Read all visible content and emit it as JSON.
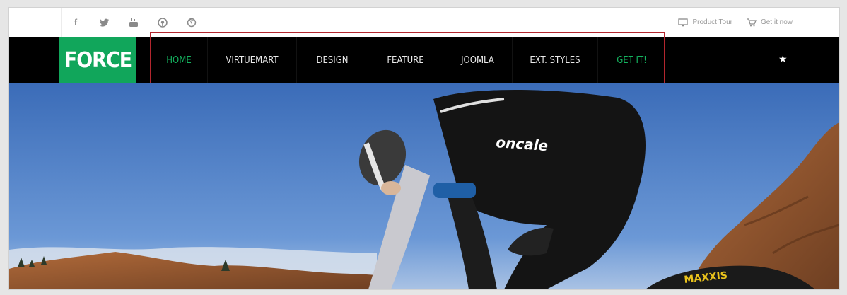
{
  "social": [
    {
      "name": "facebook-icon",
      "glyph": "f"
    },
    {
      "name": "twitter-icon",
      "glyph": "🐦"
    },
    {
      "name": "youtube-icon",
      "glyph": "▶"
    },
    {
      "name": "pinterest-icon",
      "glyph": "◉"
    },
    {
      "name": "dribbble-icon",
      "glyph": "◎"
    }
  ],
  "toplinks": {
    "product_tour": "Product Tour",
    "get_it_now": "Get it now"
  },
  "logo": "FORCE",
  "menu": [
    {
      "label": "HOME",
      "active": true
    },
    {
      "label": "VIRTUEMART",
      "active": false
    },
    {
      "label": "DESIGN",
      "active": false
    },
    {
      "label": "FEATURE",
      "active": false
    },
    {
      "label": "JOOMLA",
      "active": false
    },
    {
      "label": "EXT. STYLES",
      "active": false
    },
    {
      "label": "GET IT!",
      "active": true
    }
  ],
  "star_glyph": "★",
  "hero": {
    "jersey_text": "oncale",
    "tire_text": "MAXXIS"
  },
  "colors": {
    "accent": "#11a65b",
    "nav_bg": "#000000",
    "highlight_border": "#b3262e",
    "sky": "#4a79bf"
  }
}
